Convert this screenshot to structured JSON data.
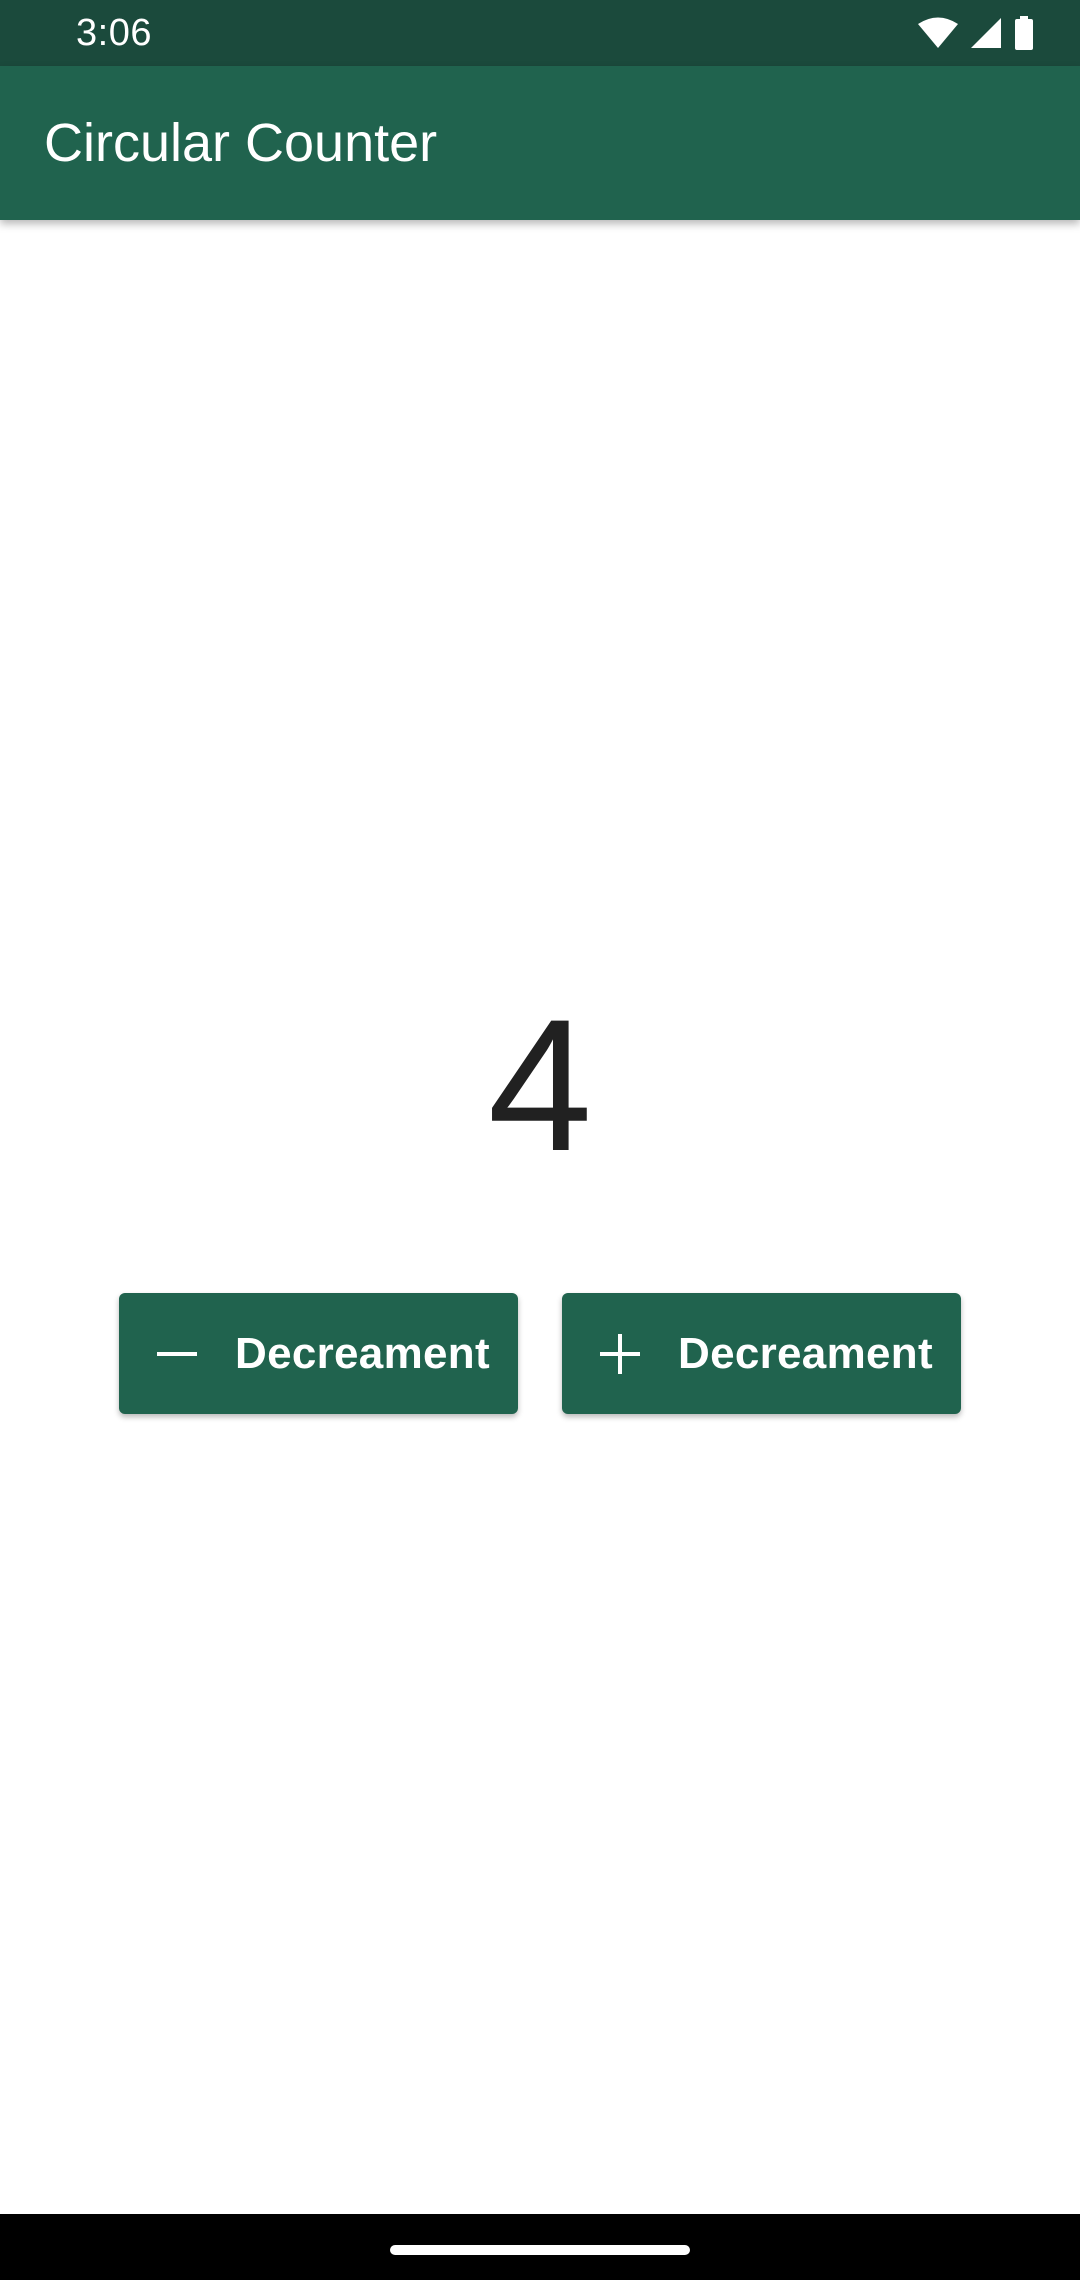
{
  "status_bar": {
    "time": "3:06",
    "icons": [
      "wifi-icon",
      "cell-signal-icon",
      "battery-icon"
    ]
  },
  "app_bar": {
    "title": "Circular Counter"
  },
  "counter": {
    "value": "4"
  },
  "buttons": {
    "decrement": {
      "icon": "minus-icon",
      "label": "Decreament"
    },
    "increment": {
      "icon": "plus-icon",
      "label": "Decreament"
    }
  },
  "colors": {
    "status_bar": "#1b4a3c",
    "primary": "#20634e",
    "counter_text": "#212121",
    "background": "#ffffff"
  }
}
